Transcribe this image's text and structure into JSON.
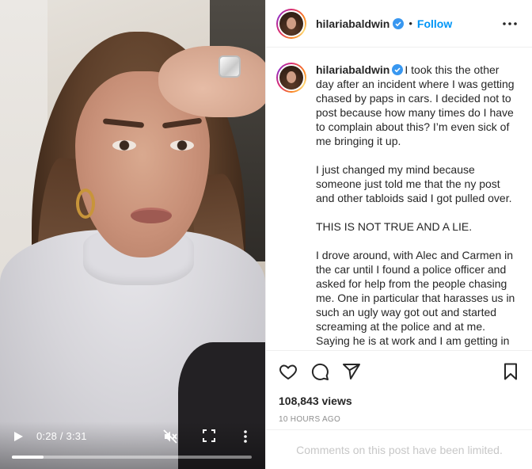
{
  "video": {
    "time_display": "0:28 / 3:31",
    "progress_fraction": 0.133
  },
  "header": {
    "username": "hilariabaldwin",
    "separator": "•",
    "follow_label": "Follow"
  },
  "caption": {
    "username": "hilariabaldwin",
    "paragraphs": [
      "I took this the other day after an incident where I was getting chased by paps in cars. I decided not to post because how many times do I have to complain about this? I’m even sick of me bringing it up.",
      "I just changed my mind because someone just told me that the ny post and other tabloids said I got pulled over.",
      "THIS IS NOT TRUE AND A LIE.",
      "I drove around, with Alec and Carmen in the car until I found a police officer and asked for help from the people chasing me. One in particular that harasses us in such an ugly way got out and started screaming at the police and at me. Saying he is at work and I am getting in"
    ]
  },
  "stats": {
    "views": "108,843 views",
    "time_ago": "10 HOURS AGO"
  },
  "comments": {
    "limited_text": "Comments on this post have been limited."
  },
  "colors": {
    "follow_blue": "#0095f6",
    "verified_blue": "#3897f0",
    "muted_text": "#8e8e8e",
    "border": "#efefef"
  }
}
